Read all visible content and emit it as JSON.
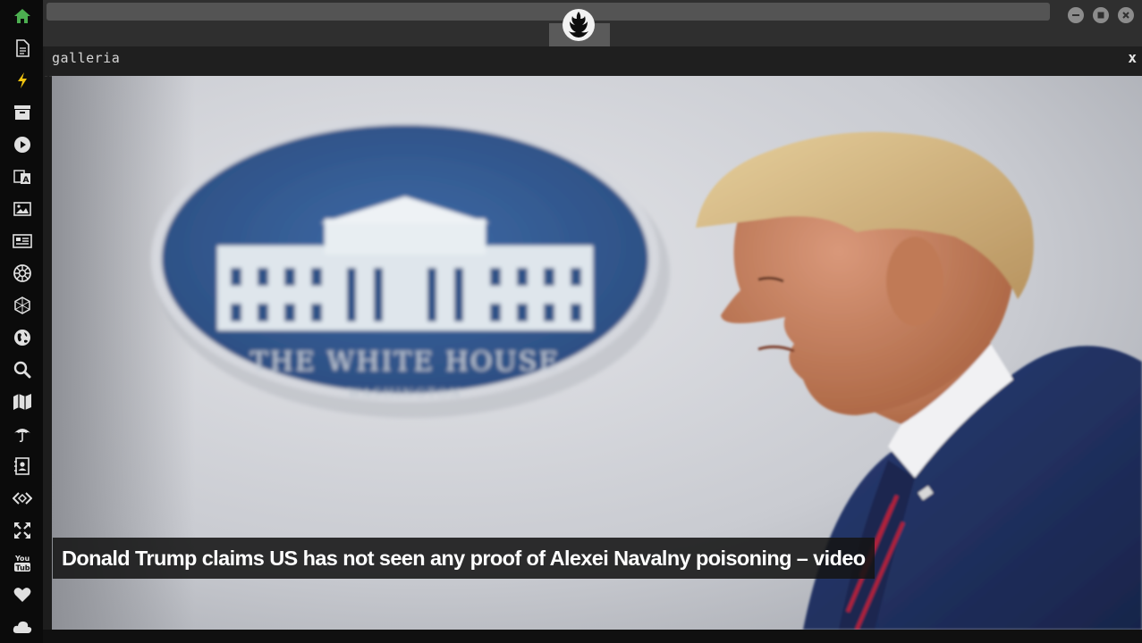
{
  "sidebar": {
    "items": [
      {
        "icon": "home-icon",
        "color": "#4caf50"
      },
      {
        "icon": "document-icon"
      },
      {
        "icon": "lightning-icon",
        "color": "#f1c40f"
      },
      {
        "icon": "archive-icon"
      },
      {
        "icon": "play-icon"
      },
      {
        "icon": "translate-icon"
      },
      {
        "icon": "image-icon"
      },
      {
        "icon": "newspaper-icon"
      },
      {
        "icon": "empire-icon"
      },
      {
        "icon": "hexagon-network-icon"
      },
      {
        "icon": "globe-icon"
      },
      {
        "icon": "search-icon"
      },
      {
        "icon": "map-icon"
      },
      {
        "icon": "umbrella-icon"
      },
      {
        "icon": "contacts-icon"
      },
      {
        "icon": "code-icon"
      },
      {
        "icon": "expand-icon"
      },
      {
        "icon": "youtube-icon"
      },
      {
        "icon": "heart-icon"
      },
      {
        "icon": "cloud-icon"
      }
    ]
  },
  "topbar": {
    "emblem_icon": "rebel-alliance-icon",
    "window_buttons": [
      "minimize-icon",
      "maximize-icon",
      "close-icon"
    ]
  },
  "panel": {
    "title": "galleria",
    "close_label": "x"
  },
  "gallery": {
    "image_description_icon": "photo",
    "caption": "Donald Trump claims US has not seen any proof of Alexei Navalny poisoning – video"
  },
  "colors": {
    "sidebar_bg": "#0b0b0b",
    "icon_default": "#e0e0e0",
    "home_icon": "#4caf50",
    "lightning_icon": "#f1c40f"
  }
}
